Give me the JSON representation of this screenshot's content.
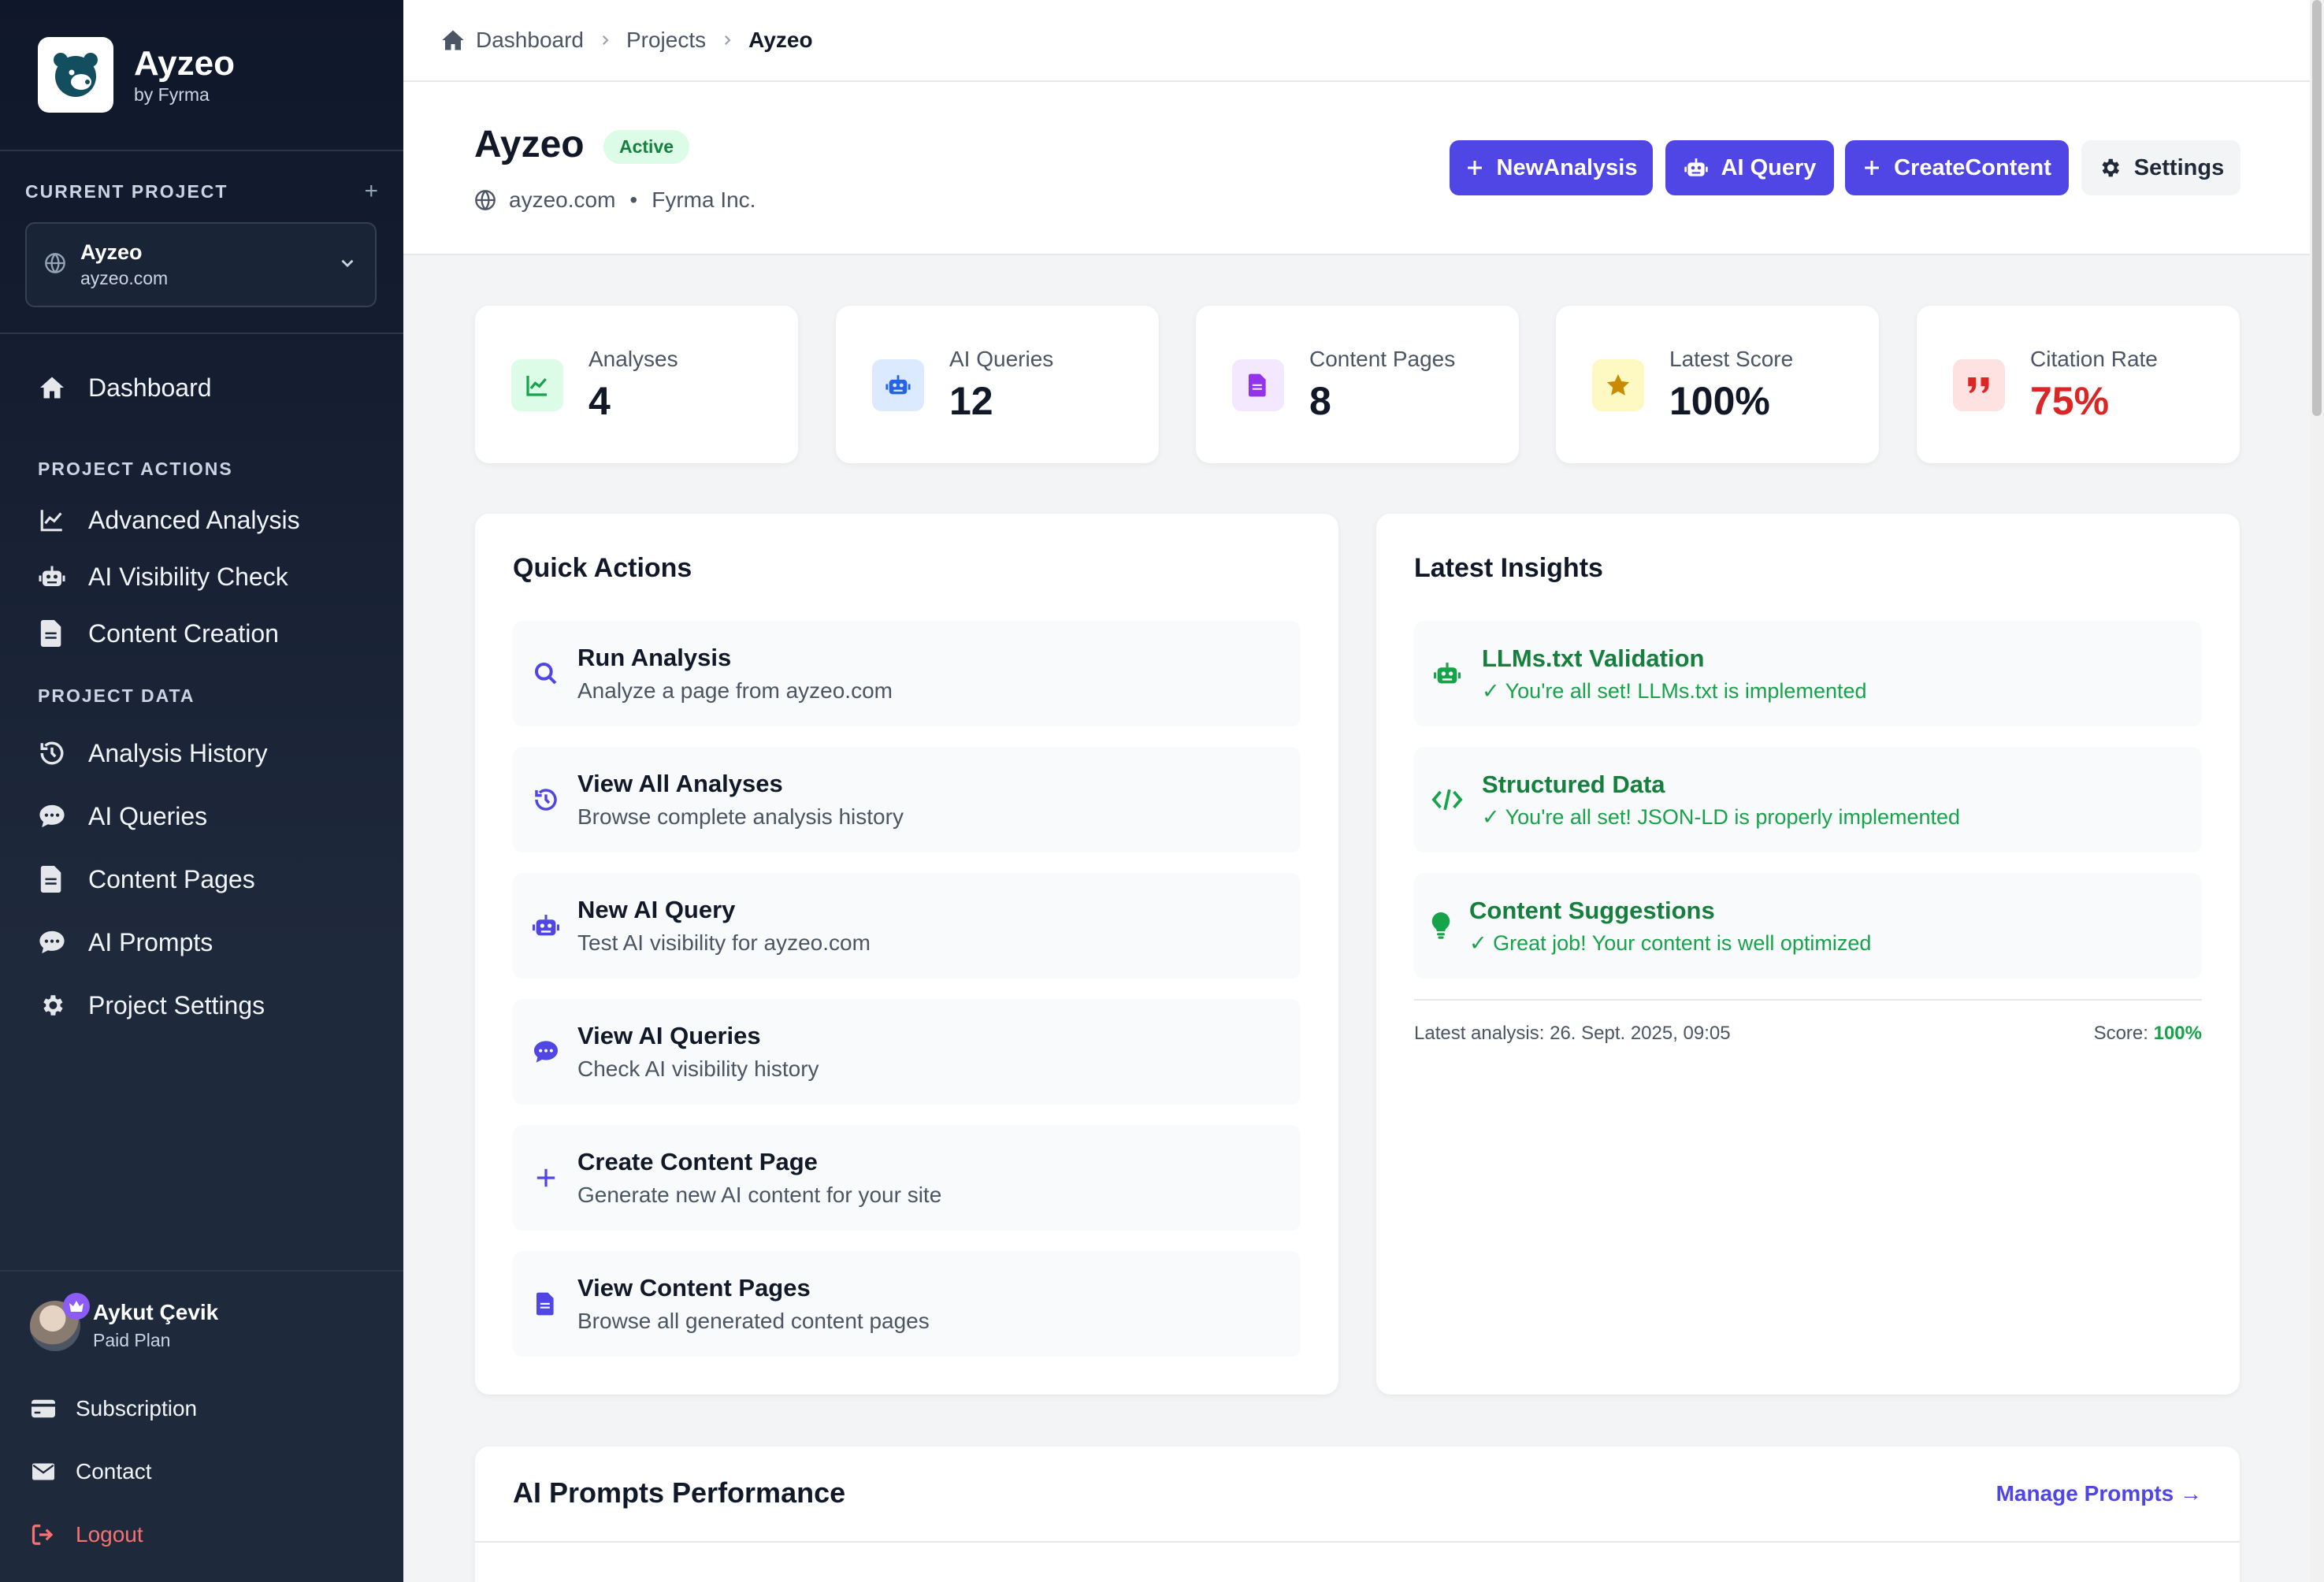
{
  "brand": {
    "name": "Ayzeo",
    "subtitle": "by Fyrma"
  },
  "current_project": {
    "section_title": "CURRENT PROJECT",
    "name": "Ayzeo",
    "url": "ayzeo.com"
  },
  "nav": {
    "dashboard": "Dashboard",
    "section_actions": "PROJECT ACTIONS",
    "advanced_analysis": "Advanced Analysis",
    "ai_visibility": "AI Visibility Check",
    "content_creation": "Content Creation",
    "section_data": "PROJECT DATA",
    "analysis_history": "Analysis History",
    "ai_queries": "AI Queries",
    "content_pages": "Content Pages",
    "ai_prompts": "AI Prompts",
    "project_settings": "Project Settings"
  },
  "user": {
    "name": "Aykut Çevik",
    "plan": "Paid Plan"
  },
  "bottom_nav": {
    "subscription": "Subscription",
    "contact": "Contact",
    "logout": "Logout"
  },
  "breadcrumb": {
    "home": "Dashboard",
    "projects": "Projects",
    "current": "Ayzeo"
  },
  "header": {
    "title": "Ayzeo",
    "status": "Active",
    "domain": "ayzeo.com",
    "company": "Fyrma Inc.",
    "buttons": {
      "new_analysis": "NewAnalysis",
      "ai_query": "AI Query",
      "create_content": "CreateContent",
      "settings": "Settings"
    }
  },
  "stats": [
    {
      "label": "Analyses",
      "value": "4"
    },
    {
      "label": "AI Queries",
      "value": "12"
    },
    {
      "label": "Content Pages",
      "value": "8"
    },
    {
      "label": "Latest Score",
      "value": "100%"
    },
    {
      "label": "Citation Rate",
      "value": "75%"
    }
  ],
  "quick_actions": {
    "title": "Quick Actions",
    "items": [
      {
        "title": "Run Analysis",
        "desc": "Analyze a page from ayzeo.com"
      },
      {
        "title": "View All Analyses",
        "desc": "Browse complete analysis history"
      },
      {
        "title": "New AI Query",
        "desc": "Test AI visibility for ayzeo.com"
      },
      {
        "title": "View AI Queries",
        "desc": "Check AI visibility history"
      },
      {
        "title": "Create Content Page",
        "desc": "Generate new AI content for your site"
      },
      {
        "title": "View Content Pages",
        "desc": "Browse all generated content pages"
      }
    ]
  },
  "insights": {
    "title": "Latest Insights",
    "items": [
      {
        "title": "LLMs.txt Validation",
        "desc": "✓ You're all set! LLMs.txt is implemented"
      },
      {
        "title": "Structured Data",
        "desc": "✓ You're all set! JSON-LD is properly implemented"
      },
      {
        "title": "Content Suggestions",
        "desc": "✓ Great job! Your content is well optimized"
      }
    ],
    "latest_analysis": "Latest analysis: 26. Sept. 2025, 09:05",
    "score_label": "Score:",
    "score_value": "100%"
  },
  "prompts_performance": {
    "title": "AI Prompts Performance",
    "link": "Manage Prompts →"
  },
  "colors": {
    "accent": "#4f46e5",
    "sidebar_bg": "#0f172a",
    "success": "#16a34a",
    "danger": "#dc2626"
  }
}
